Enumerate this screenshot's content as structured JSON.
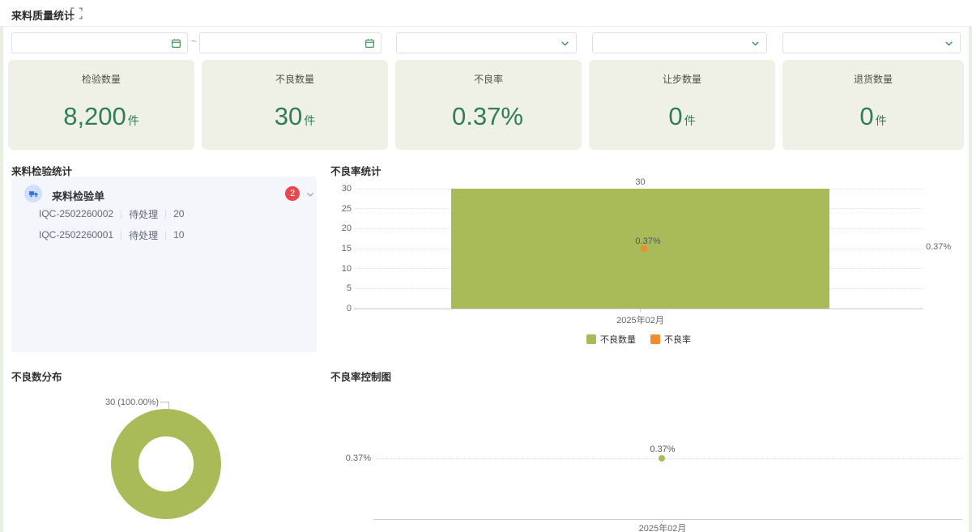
{
  "colors": {
    "olive": "#a9bb59",
    "orange": "#f18d31",
    "kpi_green": "#2f7d5a",
    "accent_green": "#44935f",
    "badge_red": "#e8474c",
    "kpi_card_bg": "#f0f1e6",
    "list_card_bg": "#f4f6fb"
  },
  "header": {
    "title": "来料质量统计"
  },
  "filters": {
    "range_separator": "~",
    "date_start_value": "",
    "date_end_value": "",
    "select1_value": "",
    "select2_value": "",
    "select3_value": ""
  },
  "kpis": [
    {
      "label": "检验数量",
      "value": "8,200",
      "unit": "件"
    },
    {
      "label": "不良数量",
      "value": "30",
      "unit": "件"
    },
    {
      "label": "不良率",
      "value": "0.37%",
      "unit": ""
    },
    {
      "label": "让步数量",
      "value": "0",
      "unit": "件"
    },
    {
      "label": "退货数量",
      "value": "0",
      "unit": "件"
    }
  ],
  "inspection_panel": {
    "title": "来料检验统计",
    "group_label": "来料检验单",
    "badge_count": "2",
    "rows": [
      {
        "code": "IQC-2502260002",
        "status": "待处理",
        "qty": "20"
      },
      {
        "code": "IQC-2502260001",
        "status": "待处理",
        "qty": "10"
      }
    ]
  },
  "chart_data": [
    {
      "id": "defect-rate-stats",
      "type": "bar",
      "title": "不良率统计",
      "categories": [
        "2025年02月"
      ],
      "series": [
        {
          "name": "不良数量",
          "type": "bar",
          "values": [
            30
          ],
          "color": "#a9bb59",
          "yaxis": "left",
          "data_label": "30"
        },
        {
          "name": "不良率",
          "type": "point",
          "values": [
            0.37
          ],
          "color": "#f18d31",
          "yaxis": "right",
          "data_label": "0.37%"
        }
      ],
      "left_axis_ticks": [
        "30",
        "25",
        "20",
        "15",
        "10",
        "5",
        "0"
      ],
      "ylim_left": [
        0,
        30
      ],
      "right_axis_ticks": [
        "0.37%"
      ],
      "legend": [
        "不良数量",
        "不良率"
      ],
      "grid": "dotted horizontal"
    },
    {
      "id": "defect-distribution",
      "type": "pie",
      "title": "不良数分布",
      "donut": true,
      "slices": [
        {
          "label": "30 (100.00%)",
          "value": 30,
          "percent": 100.0,
          "color": "#a9bb59"
        }
      ]
    },
    {
      "id": "defect-rate-control",
      "type": "scatter",
      "title": "不良率控制图",
      "x": [
        "2025年02月"
      ],
      "values": [
        0.37
      ],
      "point_labels": [
        "0.37%"
      ],
      "yaxis_ticks": [
        "0.37%"
      ],
      "color": "#a9bb59"
    }
  ]
}
